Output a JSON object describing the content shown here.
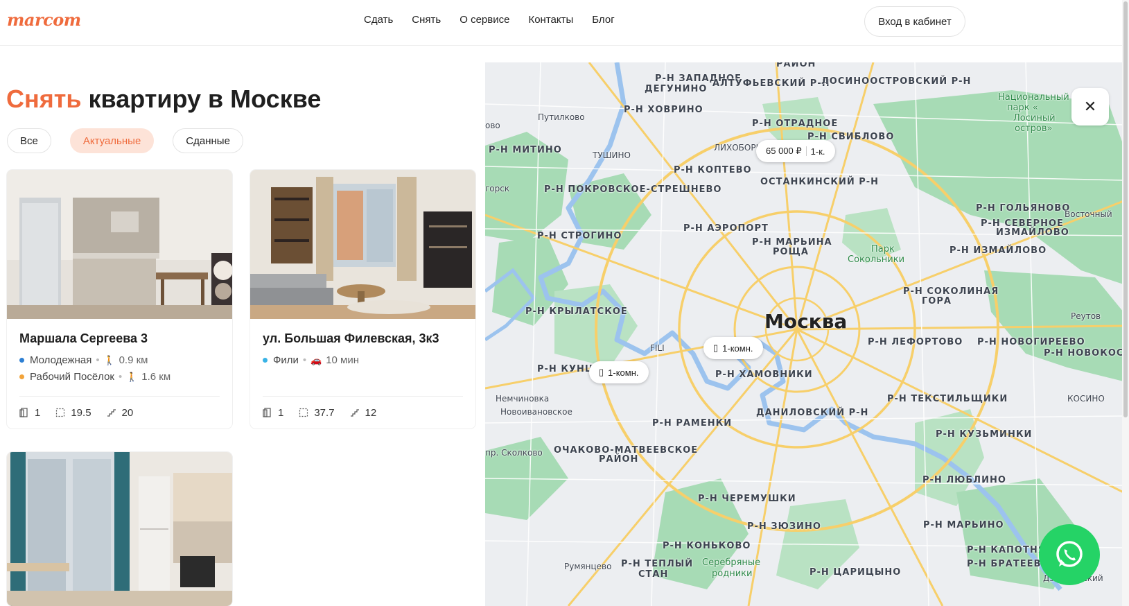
{
  "header": {
    "logo": "marcom",
    "nav": [
      "Сдать",
      "Снять",
      "О сервисе",
      "Контакты",
      "Блог"
    ],
    "login_label": "Вход в кабинет"
  },
  "title": {
    "accent": "Снять",
    "rest": " квартиру в Москве"
  },
  "filters": [
    "Все",
    "Актуальные",
    "Сданные"
  ],
  "active_filter": "Актуальные",
  "listings": [
    {
      "address": "Маршала Сергеева 3",
      "metro": [
        {
          "name": "Молодежная",
          "color": "#2d7fd3",
          "mode": "walk-icon",
          "distance": "0.9 км"
        },
        {
          "name": "Рабочий Посёлок",
          "color": "#f2a33a",
          "mode": "walk-icon",
          "distance": "1.6 км"
        }
      ],
      "rooms": "1",
      "area": "19.5",
      "floor": "20"
    },
    {
      "address": "ул. Большая Филевская, 3к3",
      "metro": [
        {
          "name": "Фили",
          "color": "#39b3e6",
          "mode": "car-icon",
          "distance": "10 мин"
        }
      ],
      "rooms": "1",
      "area": "37.7",
      "floor": "12"
    }
  ],
  "map": {
    "city": "Москва",
    "pins": [
      {
        "price": "65 000 ₽",
        "type": "1-к."
      },
      {
        "type": "1-комн."
      },
      {
        "type": "1-комн."
      }
    ],
    "labels": [
      "РАЙОН",
      "Р-Н ЗАПАДНОЕ",
      "ДЕГУНИНО",
      "АЛТУФЬЕВСКИЙ Р-Н",
      "ЛОСИНООСТРОВСКИЙ Р-Н",
      "Р-Н ХОВРИНО",
      "Путилково",
      "Р-Н ОТРАДНОЕ",
      "Р-Н СВИБЛОВО",
      "Р-Н МИТИНО",
      "ТУШИНО",
      "ЛИХОБОРЫ",
      "Р-Н КОПТЕВО",
      "ОСТАНКИНСКИЙ Р-Н",
      "Р-Н ПОКРОВСКОЕ-СТРЕШНЕВО",
      "Р-Н АЭРОПОРТ",
      "Р-Н СТРОГИНО",
      "Р-Н МАРЬИНА",
      "РОЩА",
      "Парк",
      "Сокольники",
      "Р-Н ГОЛЬЯНОВО",
      "Восточный",
      "Р-Н СЕВЕРНОЕ",
      "ИЗМАЙЛОВО",
      "Р-Н ИЗМАЙЛОВО",
      "Р-Н КРЫЛАТСКОЕ",
      "Р-Н СОКОЛИНАЯ",
      "ГОРА",
      "Реутов",
      "Р-Н ЛЕФОРТОВО",
      "Р-Н НОВОГИРЕЕВО",
      "Р-Н НОВОКОСИ",
      "Р-Н КУНЦЕВО",
      "Р-Н ХАМОВНИКИ",
      "Немчиновка",
      "Новоивановское",
      "Р-Н ТЕКСТИЛЬЩИКИ",
      "Р-Н РАМЕНКИ",
      "ДАНИЛОВСКИЙ Р-Н",
      "КОСИНО",
      "Р-Н КУЗЬМИНКИ",
      "ОЧАКОВО-МАТВЕЕВСКОЕ",
      "РАЙОН",
      "Р-Н ЛЮБЛИНО",
      "Р-Н ЧЕРЕМУШКИ",
      "Р-Н ЗЮЗИНО",
      "Р-Н МАРЬИНО",
      "Р-Н КОНЬКОВО",
      "Р-Н ТЕПЛЫЙ",
      "СТАН",
      "Серебряные",
      "родники",
      "Р-Н КАПОТНЯ",
      "Р-Н БРАТЕЕВО",
      "Румянцево",
      "Р-Н ЦАРИЦЫНО",
      "Дзержинский",
      "Национальный",
      "парк «",
      "Лосиный",
      "остров»",
      "горск",
      "ово",
      "FILI",
      "пр. Сколково"
    ]
  },
  "icons": {
    "close": "close-icon",
    "whatsapp": "whatsapp-icon",
    "rooms": "door-icon",
    "area": "area-icon",
    "floor": "stairs-icon"
  },
  "colors": {
    "accent": "#ef6b3d",
    "active_chip_bg": "#fde3d8",
    "whatsapp": "#25d366",
    "map_park": "#a7dbb5",
    "map_road": "#f7cf6a",
    "map_water": "#9cc3ee"
  }
}
